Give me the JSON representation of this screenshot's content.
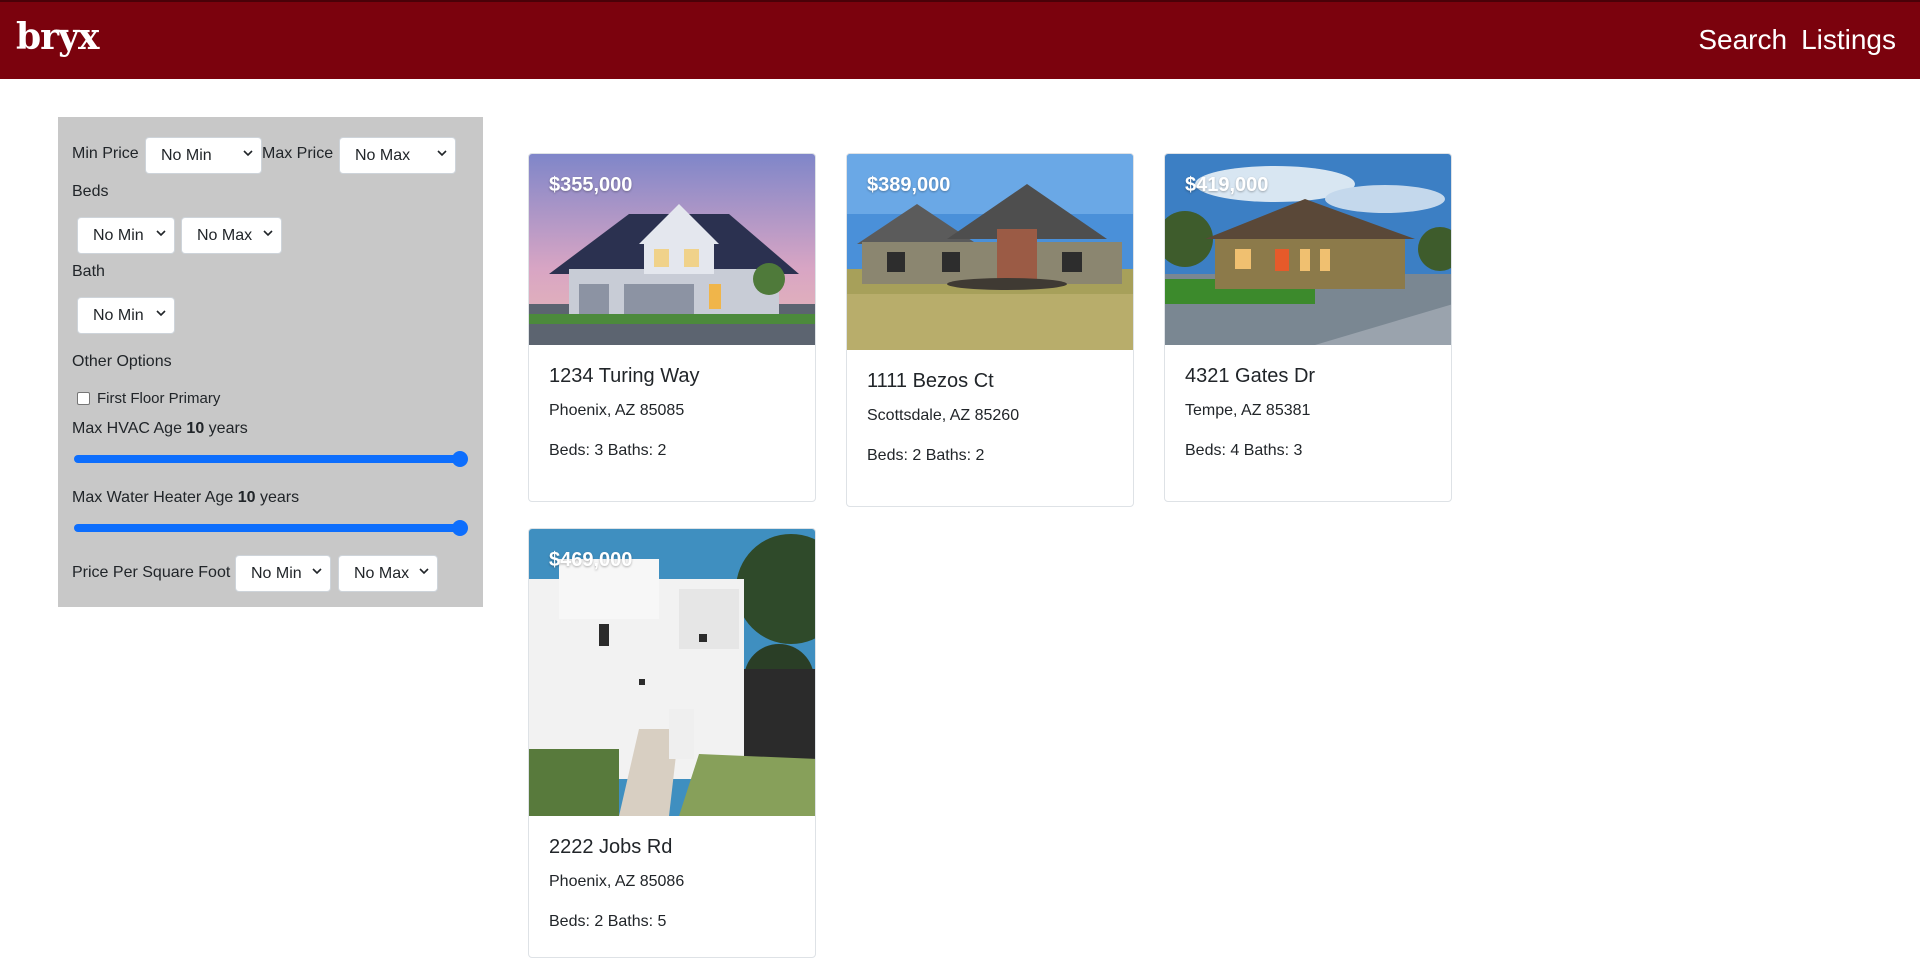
{
  "navbar": {
    "brand": "bryx",
    "links": [
      "Search",
      "Listings"
    ]
  },
  "filters": {
    "min_price_label": "Min Price",
    "min_price_value": "No Min",
    "max_price_label": "Max Price",
    "max_price_value": "No Max",
    "beds_label": "Beds",
    "beds_min_value": "No Min",
    "beds_max_value": "No Max",
    "bath_label": "Bath",
    "bath_min_value": "No Min",
    "other_options_label": "Other Options",
    "first_floor_label": "First Floor Primary",
    "first_floor_checked": false,
    "hvac_label_prefix": "Max HVAC Age ",
    "hvac_value": "10",
    "hvac_label_suffix": " years",
    "water_label_prefix": "Max Water Heater Age ",
    "water_value": "10",
    "water_label_suffix": " years",
    "ppsf_label": "Price Per Square Foot",
    "ppsf_min_value": "No Min",
    "ppsf_max_value": "No Max"
  },
  "listings": [
    {
      "price": "$355,000",
      "address": "1234 Turing Way",
      "city": "Phoenix, AZ 85085",
      "details": "Beds: 3 Baths: 2"
    },
    {
      "price": "$389,000",
      "address": "1111 Bezos Ct",
      "city": "Scottsdale, AZ 85260",
      "details": "Beds: 2 Baths: 2"
    },
    {
      "price": "$419,000",
      "address": "4321 Gates Dr",
      "city": "Tempe, AZ 85381",
      "details": "Beds: 4 Baths: 3"
    },
    {
      "price": "$469,000",
      "address": "2222 Jobs Rd",
      "city": "Phoenix, AZ 85086",
      "details": "Beds: 2 Baths: 5"
    }
  ],
  "colors": {
    "navbar": "#7b020d",
    "filter_panel": "#c8c8c8",
    "slider_accent": "#0d6efd"
  }
}
